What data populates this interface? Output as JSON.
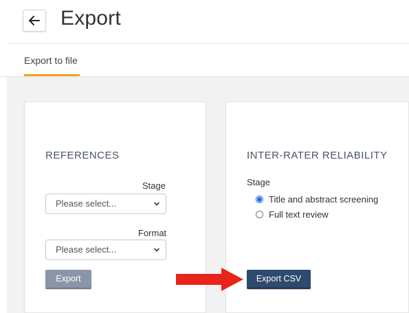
{
  "header": {
    "back_icon": "arrow-left-icon",
    "title": "Export"
  },
  "tabs": [
    {
      "label": "Export to file",
      "active": true
    }
  ],
  "accent_color": "#f1a31c",
  "references_card": {
    "heading": "REFERENCES",
    "stage": {
      "label": "Stage",
      "placeholder": "Please select..."
    },
    "format": {
      "label": "Format",
      "placeholder": "Please select..."
    },
    "export_button": "Export"
  },
  "irr_card": {
    "heading": "INTER-RATER RELIABILITY",
    "stage_label": "Stage",
    "options": [
      {
        "label": "Title and abstract screening",
        "checked": true
      },
      {
        "label": "Full text review",
        "checked": false
      }
    ],
    "export_button": "Export CSV"
  },
  "annotation": {
    "arrow_color": "#e8231a",
    "arrow_points_to": "Export CSV"
  }
}
